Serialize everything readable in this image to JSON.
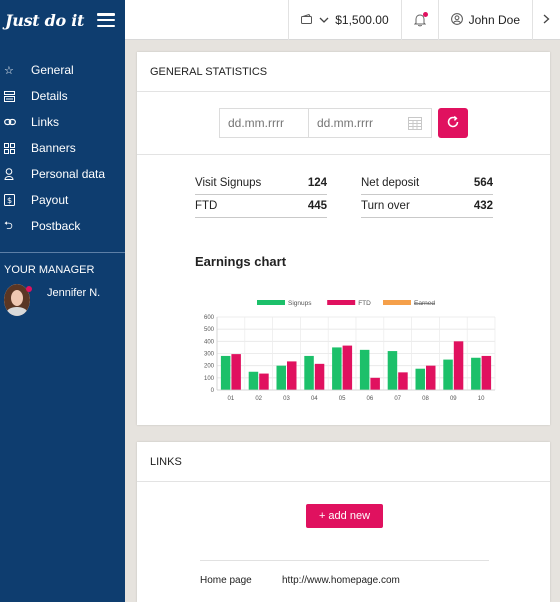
{
  "brand": {
    "logo_text": "Just do it"
  },
  "sidebar": {
    "items": [
      {
        "label": "General",
        "icon": "star-icon"
      },
      {
        "label": "Details",
        "icon": "details-icon"
      },
      {
        "label": "Links",
        "icon": "link-icon"
      },
      {
        "label": "Banners",
        "icon": "banners-icon"
      },
      {
        "label": "Personal data",
        "icon": "user-icon"
      },
      {
        "label": "Payout",
        "icon": "payout-icon"
      },
      {
        "label": "Postback",
        "icon": "postback-icon"
      }
    ],
    "manager_title": "YOUR MANAGER",
    "manager_name": "Jennifer N."
  },
  "topbar": {
    "balance": "$1,500.00",
    "user_name": "John Doe",
    "notification_color": "#e0115f"
  },
  "general_statistics": {
    "title": "GENERAL STATISTICS",
    "date_from_placeholder": "dd.mm.rrrr",
    "date_to_placeholder": "dd.mm.rrrr",
    "stats": [
      {
        "label": "Visit Signups",
        "value": "124"
      },
      {
        "label": "FTD",
        "value": "445"
      },
      {
        "label": "Net deposit",
        "value": "564"
      },
      {
        "label": "Turn over",
        "value": "432"
      }
    ],
    "chart_title": "Earnings chart"
  },
  "chart_data": {
    "type": "bar",
    "title": "Earnings chart",
    "categories": [
      "01",
      "02",
      "03",
      "04",
      "05",
      "06",
      "07",
      "08",
      "09",
      "10"
    ],
    "y_ticks": [
      "0",
      "100",
      "200",
      "300",
      "400",
      "500",
      "600"
    ],
    "ylim": [
      0,
      600
    ],
    "grid": true,
    "legend_position": "top",
    "series": [
      {
        "name": "Signups",
        "color": "#1cc06a",
        "values": [
          280,
          150,
          200,
          280,
          350,
          330,
          320,
          175,
          250,
          265
        ]
      },
      {
        "name": "FTD",
        "color": "#e0115f",
        "values": [
          295,
          135,
          235,
          215,
          365,
          100,
          145,
          200,
          400,
          280
        ]
      },
      {
        "name": "Earned",
        "color": "#f5a04a",
        "values": [],
        "struck": true
      }
    ]
  },
  "links_panel": {
    "title": "LINKS",
    "add_label": "+ add new",
    "rows": [
      {
        "name": "Home page",
        "url": "http://www.homepage.com"
      }
    ]
  }
}
